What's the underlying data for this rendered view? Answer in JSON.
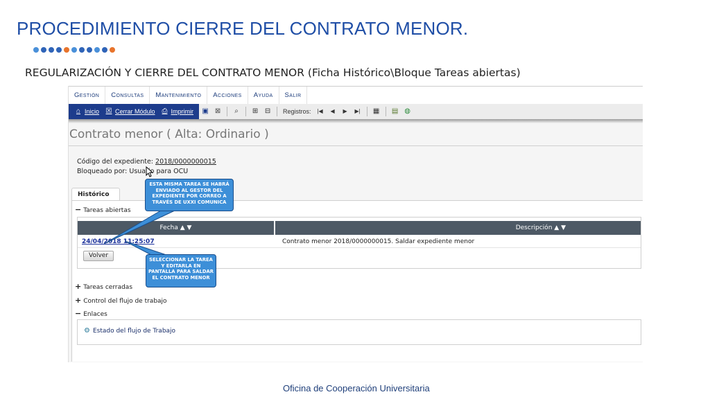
{
  "slide": {
    "title": "PROCEDIMIENTO CIERRE DEL CONTRATO MENOR.",
    "subtitle": "REGULARIZACIÓN Y CIERRE DEL CONTRATO MENOR (Ficha Histórico\\Bloque Tareas abiertas)",
    "footer": "Oficina de Cooperación Universitaria",
    "dot_colors": [
      "#4a90d9",
      "#2f64b8",
      "#2f64b8",
      "#2f64b8",
      "#e8742c",
      "#4a90d9",
      "#2f64b8",
      "#2f64b8",
      "#4a90d9",
      "#2f64b8",
      "#e8742c"
    ]
  },
  "menu": {
    "items": [
      "Gestión",
      "Consultas",
      "Mantenimiento",
      "Acciones",
      "Ayuda",
      "Salir"
    ]
  },
  "toolbar": {
    "inicio": "Inicio",
    "cerrar": "Cerrar Módulo",
    "imprimir": "Imprimir",
    "registros": "Registros:"
  },
  "form": {
    "title": "Contrato menor ( Alta: Ordinario )",
    "codigo_label": "Código del expediente:",
    "codigo_value": "2018/0000000015",
    "bloqueado_label": "Bloqueado por:",
    "bloqueado_value": "Usuario para OCU"
  },
  "tabs": {
    "historico": "Histórico"
  },
  "sections": {
    "abiertas": "Tareas abiertas",
    "cerradas": "Tareas cerradas",
    "control": "Control del flujo de trabajo",
    "enlaces": "Enlaces"
  },
  "table": {
    "col_fecha": "Fecha",
    "col_desc": "Descripción",
    "sort_glyph": "▲ ▼",
    "rows": [
      {
        "fecha": "24/04/2018 11:25:07",
        "descripcion": "Contrato menor 2018/0000000015. Saldar expediente menor"
      }
    ]
  },
  "buttons": {
    "volver": "Volver"
  },
  "links": {
    "estado": "Estado del flujo de Trabajo"
  },
  "callouts": {
    "top": "ESTA MISMA TAREA SE HABRÁ ENVIADO AL GESTOR DEL EXPEDIENTE POR CORREO A TRAVÉS DE UXXI COMUNICA",
    "bottom": "SELECCIONAR LA TAREA Y EDITARLA EN PANTALLA PARA SALDAR EL CONTRATO MENOR"
  }
}
